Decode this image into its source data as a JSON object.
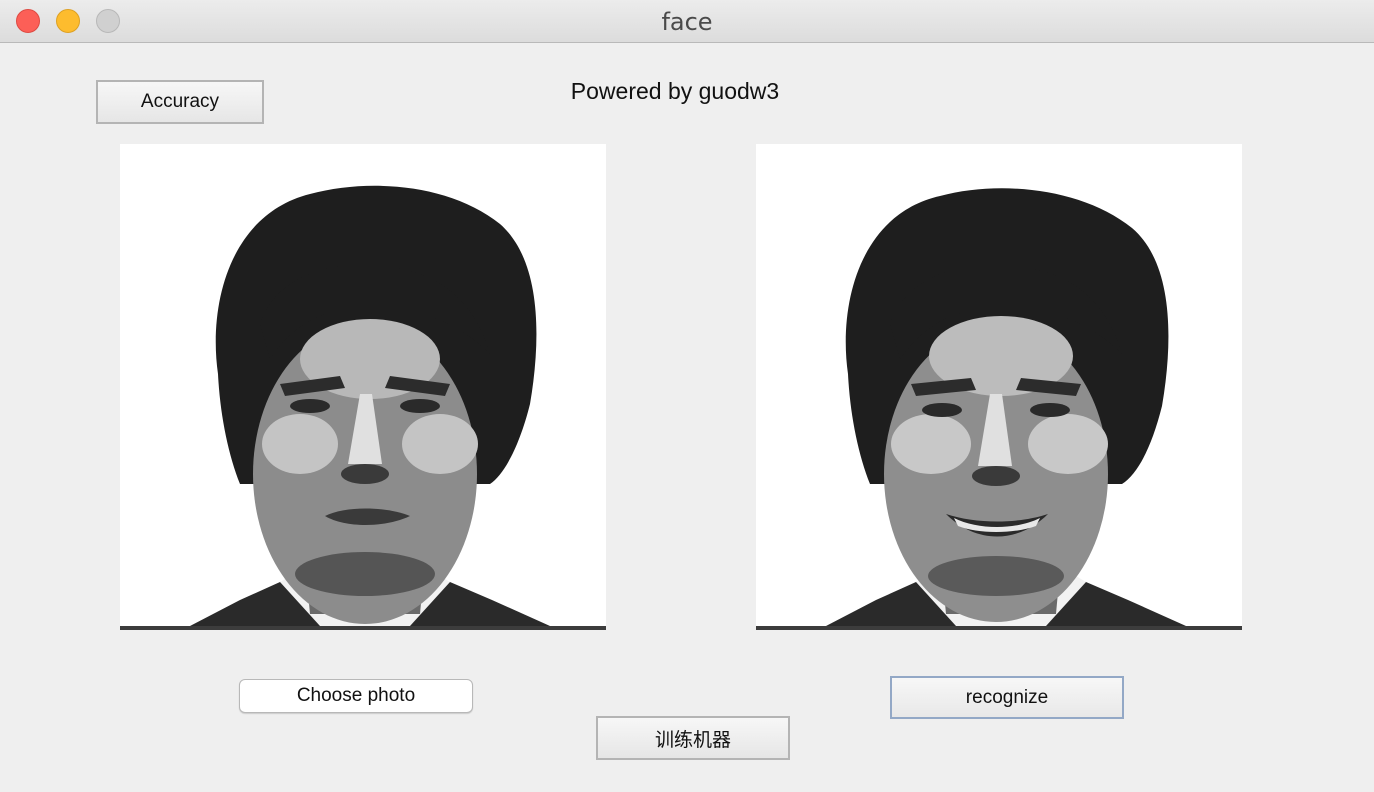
{
  "window": {
    "title": "face"
  },
  "header": {
    "accuracy_label": "Accuracy",
    "powered_text": "Powered by guodw3"
  },
  "photos": {
    "left": {
      "description_icon": "face-photo-neutral-icon"
    },
    "right": {
      "description_icon": "face-photo-smiling-icon"
    }
  },
  "actions": {
    "choose_label": "Choose photo",
    "recognize_label": "recognize",
    "train_label": "训练机器"
  },
  "colors": {
    "close": "#fc5f57",
    "minimize": "#fdbc2e",
    "maximize": "#d0d0d0",
    "focus_border": "#93a8c6"
  }
}
